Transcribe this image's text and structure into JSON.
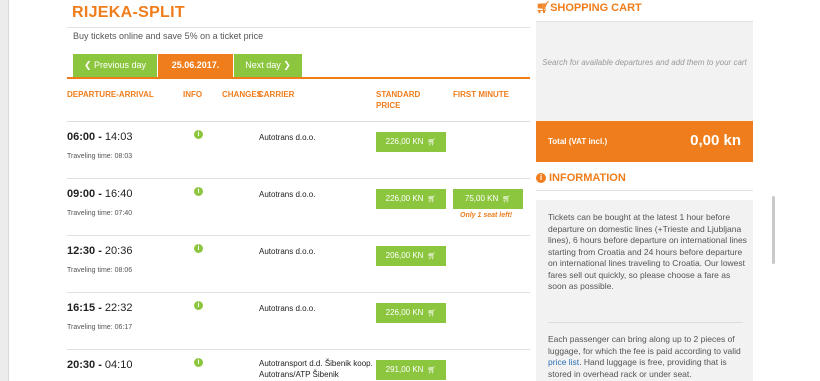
{
  "page": {
    "title": "RIJEKA-SPLIT",
    "subtitle": "Buy tickets online and save 5% on a ticket price"
  },
  "nav": {
    "prev": "Previous day",
    "date": "25.06.2017.",
    "next": "Next day"
  },
  "headers": {
    "departure": "DEPARTURE-ARRIVAL",
    "info": "INFO",
    "changes": "CHANGES",
    "carrier": "CARRIER",
    "standard": "STANDARD PRICE",
    "first_minute": "FIRST MINUTE"
  },
  "rows": [
    {
      "dep": "06:00",
      "arr": "14:03",
      "travel": "Traveling time: 08:03",
      "carrier": "Autotrans d.o.o.",
      "standard": "226,00 KN",
      "first_minute": "",
      "seat_note": ""
    },
    {
      "dep": "09:00",
      "arr": "16:40",
      "travel": "Traveling time: 07:40",
      "carrier": "Autotrans d.o.o.",
      "standard": "226,00 KN",
      "first_minute": "75,00 KN",
      "seat_note": "Only 1 seat left!"
    },
    {
      "dep": "12:30",
      "arr": "20:36",
      "travel": "Traveling time: 08:06",
      "carrier": "Autotrans d.o.o.",
      "standard": "206,00 KN",
      "first_minute": "",
      "seat_note": ""
    },
    {
      "dep": "16:15",
      "arr": "22:32",
      "travel": "Traveling time: 06:17",
      "carrier": "Autotrans d.o.o.",
      "standard": "226,00 KN",
      "first_minute": "",
      "seat_note": ""
    },
    {
      "dep": "20:30",
      "arr": "04:10",
      "travel": "",
      "carrier": "Autotransport d.d. Šibenik koop. Autotrans/ATP Šibenik",
      "standard": "291,00 KN",
      "first_minute": "",
      "seat_note": ""
    }
  ],
  "cart": {
    "title": "SHOPPING CART",
    "empty_text": "Search for available departures and add them to your cart",
    "total_label": "Total (VAT incl.)",
    "total_value": "0,00 kn"
  },
  "info": {
    "title": "INFORMATION",
    "p1": "Tickets can be bought at the latest 1 hour before departure on domestic lines (+Trieste and Ljubljana lines), 6 hours before departure on international lines starting from Croatia and 24 hours before departure on international lines traveling to Croatia. Our lowest fares sell out quickly, so please choose a fare as soon as possible.",
    "p2_a": "Each passenger can bring along up to 2 pieces of luggage, for which the fee is paid according to valid ",
    "p2_link": "price list",
    "p2_b": ". Hand luggage is free, providing that is stored in overhead rack or under seat."
  },
  "icons": {
    "info": "info-circle-icon",
    "cart": "shopping-cart-icon",
    "chevron_left": "chevron-left-icon",
    "chevron_right": "chevron-right-icon"
  },
  "colors": {
    "accent_orange": "#f07d1b",
    "accent_green": "#8cc63f"
  }
}
